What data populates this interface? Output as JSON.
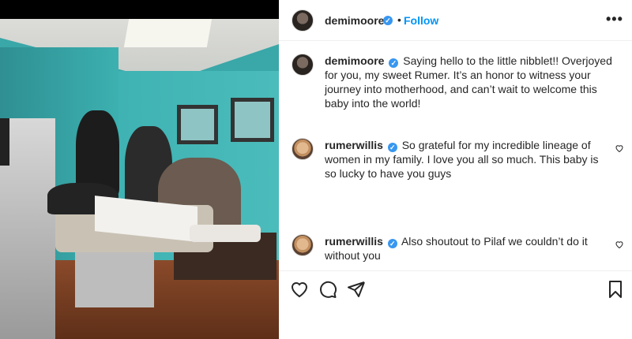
{
  "post_author": {
    "username": "demimoore",
    "verified": true,
    "separator": "•",
    "follow_label": "Follow",
    "more_label": "•••"
  },
  "caption": {
    "username": "demimoore",
    "text": "Saying hello to the little nibblet!! Overjoyed for you, my sweet Rumer. It’s an honor to witness your journey into motherhood, and can’t wait to welcome this baby into the world!"
  },
  "comments": [
    {
      "username": "rumerwillis",
      "verified": true,
      "text": "So grateful for my incredible lineage of women in my family. I love you all so much. This baby is so lucky to have you guys"
    },
    {
      "username": "rumerwillis",
      "verified": true,
      "text": "Also shoutout to Pilaf we couldn’t do it without you"
    }
  ],
  "icons": {
    "like": "heart-icon",
    "comment": "comment-icon",
    "share": "paper-plane-icon",
    "save": "bookmark-icon",
    "verified": "verified-badge-icon",
    "comment_like": "heart-icon"
  },
  "colors": {
    "link": "#0095f6",
    "verified": "#3897f0",
    "text": "#262626",
    "divider": "#efefef"
  }
}
